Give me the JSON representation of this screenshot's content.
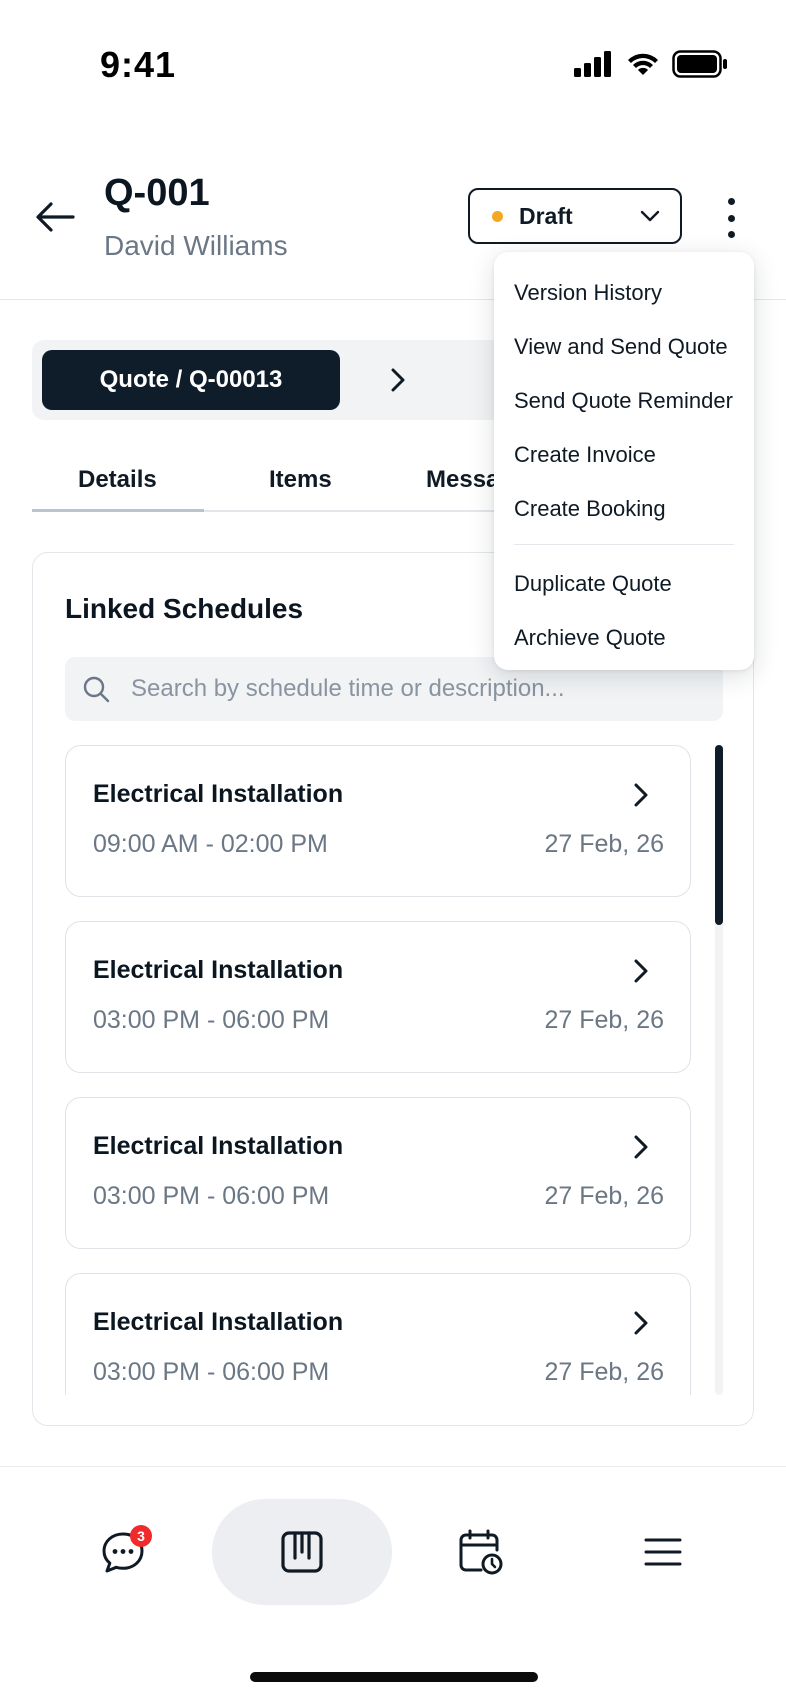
{
  "status_bar": {
    "time": "9:41"
  },
  "header": {
    "quote_id": "Q-001",
    "customer_name": "David Williams",
    "status": {
      "label": "Draft",
      "dot_color": "#f5a623"
    }
  },
  "breadcrumb": {
    "label": "Quote / Q-00013"
  },
  "tabs": [
    {
      "label": "Details",
      "active": true
    },
    {
      "label": "Items",
      "active": false
    },
    {
      "label": "Messa",
      "active": false
    }
  ],
  "linked_schedules": {
    "title": "Linked Schedules",
    "search_placeholder": "Search by schedule time or description...",
    "items": [
      {
        "title": "Electrical Installation",
        "time": "09:00 AM - 02:00 PM",
        "date": "27 Feb, 26"
      },
      {
        "title": "Electrical Installation",
        "time": "03:00 PM - 06:00 PM",
        "date": "27 Feb, 26"
      },
      {
        "title": "Electrical Installation",
        "time": "03:00 PM - 06:00 PM",
        "date": "27 Feb, 26"
      },
      {
        "title": "Electrical Installation",
        "time": "03:00 PM - 06:00 PM",
        "date": "27 Feb, 26"
      }
    ]
  },
  "dropdown_menu": {
    "group1": [
      "Version History",
      "View and Send Quote",
      "Send Quote Reminder",
      "Create Invoice",
      "Create Booking"
    ],
    "group2": [
      "Duplicate Quote",
      "Archieve Quote"
    ]
  },
  "bottom_nav": {
    "items": [
      {
        "icon": "chat-icon",
        "badge": "3"
      },
      {
        "icon": "board-icon",
        "active": true
      },
      {
        "icon": "calendar-clock-icon"
      },
      {
        "icon": "menu-icon"
      }
    ]
  },
  "colors": {
    "primary": "#0f1d2b",
    "badge": "#ef2b2b",
    "draft_dot": "#f5a623",
    "muted": "#6b7785"
  }
}
